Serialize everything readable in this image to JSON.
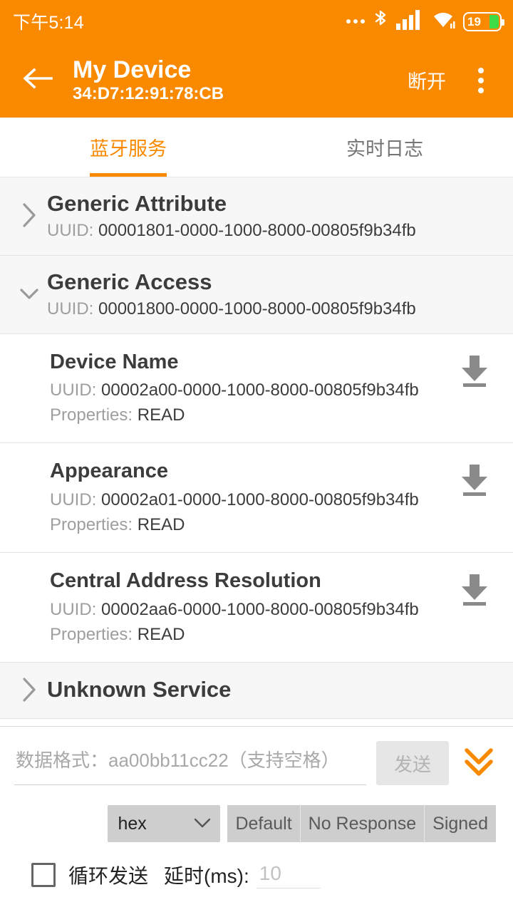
{
  "statusbar": {
    "time": "下午5:14",
    "battery_level": "19",
    "icons": [
      "more-dots-icon",
      "bluetooth-icon",
      "signal-icon",
      "wifi-icon",
      "battery-icon"
    ]
  },
  "appbar": {
    "back_icon": "back-arrow-icon",
    "device_name": "My Device",
    "device_mac": "34:D7:12:91:78:CB",
    "disconnect_label": "断开",
    "overflow_icon": "overflow-menu-icon",
    "accent_color": "#F98A00"
  },
  "tabs": [
    {
      "label": "蓝牙服务",
      "active": true
    },
    {
      "label": "实时日志",
      "active": false
    }
  ],
  "labels": {
    "uuid_prefix": "UUID:",
    "properties_prefix": "Properties:"
  },
  "services": [
    {
      "name": "Generic Attribute",
      "uuid": "00001801-0000-1000-8000-00805f9b34fb",
      "expanded": false,
      "chevron": "chevron-right-icon",
      "characteristics": []
    },
    {
      "name": "Generic Access",
      "uuid": "00001800-0000-1000-8000-00805f9b34fb",
      "expanded": true,
      "chevron": "chevron-down-icon",
      "characteristics": [
        {
          "name": "Device Name",
          "uuid": "00002a00-0000-1000-8000-00805f9b34fb",
          "properties": "READ",
          "action_icon": "download-read-icon"
        },
        {
          "name": "Appearance",
          "uuid": "00002a01-0000-1000-8000-00805f9b34fb",
          "properties": "READ",
          "action_icon": "download-read-icon"
        },
        {
          "name": "Central Address Resolution",
          "uuid": "00002aa6-0000-1000-8000-00805f9b34fb",
          "properties": "READ",
          "action_icon": "download-read-icon"
        }
      ]
    },
    {
      "name": "Unknown Service",
      "uuid": "",
      "expanded": false,
      "chevron": "chevron-right-icon",
      "characteristics": []
    }
  ],
  "bottom_panel": {
    "data_placeholder": "数据格式：aa00bb11cc22（支持空格）",
    "data_value": "",
    "send_label": "发送",
    "send_disabled": true,
    "collapse_icon": "double-chevron-down-icon",
    "format_selected": "hex",
    "format_chevron": "chevron-down-icon",
    "write_modes": [
      "Default",
      "No Response",
      "Signed"
    ],
    "loop_checkbox_checked": false,
    "loop_label": "循环发送",
    "delay_label": "延时(ms):",
    "delay_placeholder": "10",
    "delay_value": ""
  }
}
